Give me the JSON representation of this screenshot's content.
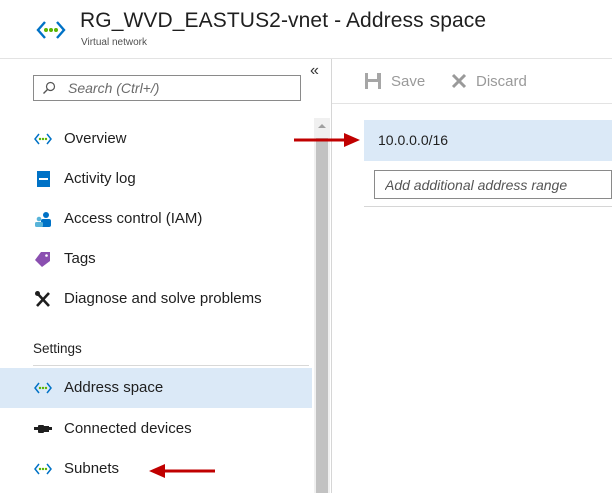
{
  "header": {
    "title": "RG_WVD_EASTUS2-vnet - Address space",
    "subtitle": "Virtual network",
    "icon": "virtual-network-icon"
  },
  "sidebar": {
    "search_placeholder": "Search (Ctrl+/)",
    "collapse_label": "«",
    "items": [
      {
        "label": "Overview",
        "icon": "virtual-network-icon"
      },
      {
        "label": "Activity log",
        "icon": "activity-log-icon"
      },
      {
        "label": "Access control (IAM)",
        "icon": "people-icon"
      },
      {
        "label": "Tags",
        "icon": "tag-icon"
      },
      {
        "label": "Diagnose and solve problems",
        "icon": "wrench-cross-icon"
      }
    ],
    "settings_header": "Settings",
    "settings_items": [
      {
        "label": "Address space",
        "icon": "virtual-network-icon",
        "selected": true
      },
      {
        "label": "Connected devices",
        "icon": "plug-icon"
      },
      {
        "label": "Subnets",
        "icon": "virtual-network-icon"
      }
    ]
  },
  "toolbar": {
    "save_label": "Save",
    "discard_label": "Discard"
  },
  "address_space": {
    "ranges": [
      "10.0.0.0/16"
    ],
    "add_placeholder": "Add additional address range"
  },
  "colors": {
    "selected_bg": "#dbe9f7",
    "annotation_arrow": "#c00000",
    "vnet_icon_green": "#5ab500",
    "vnet_icon_blue": "#0072c6"
  }
}
